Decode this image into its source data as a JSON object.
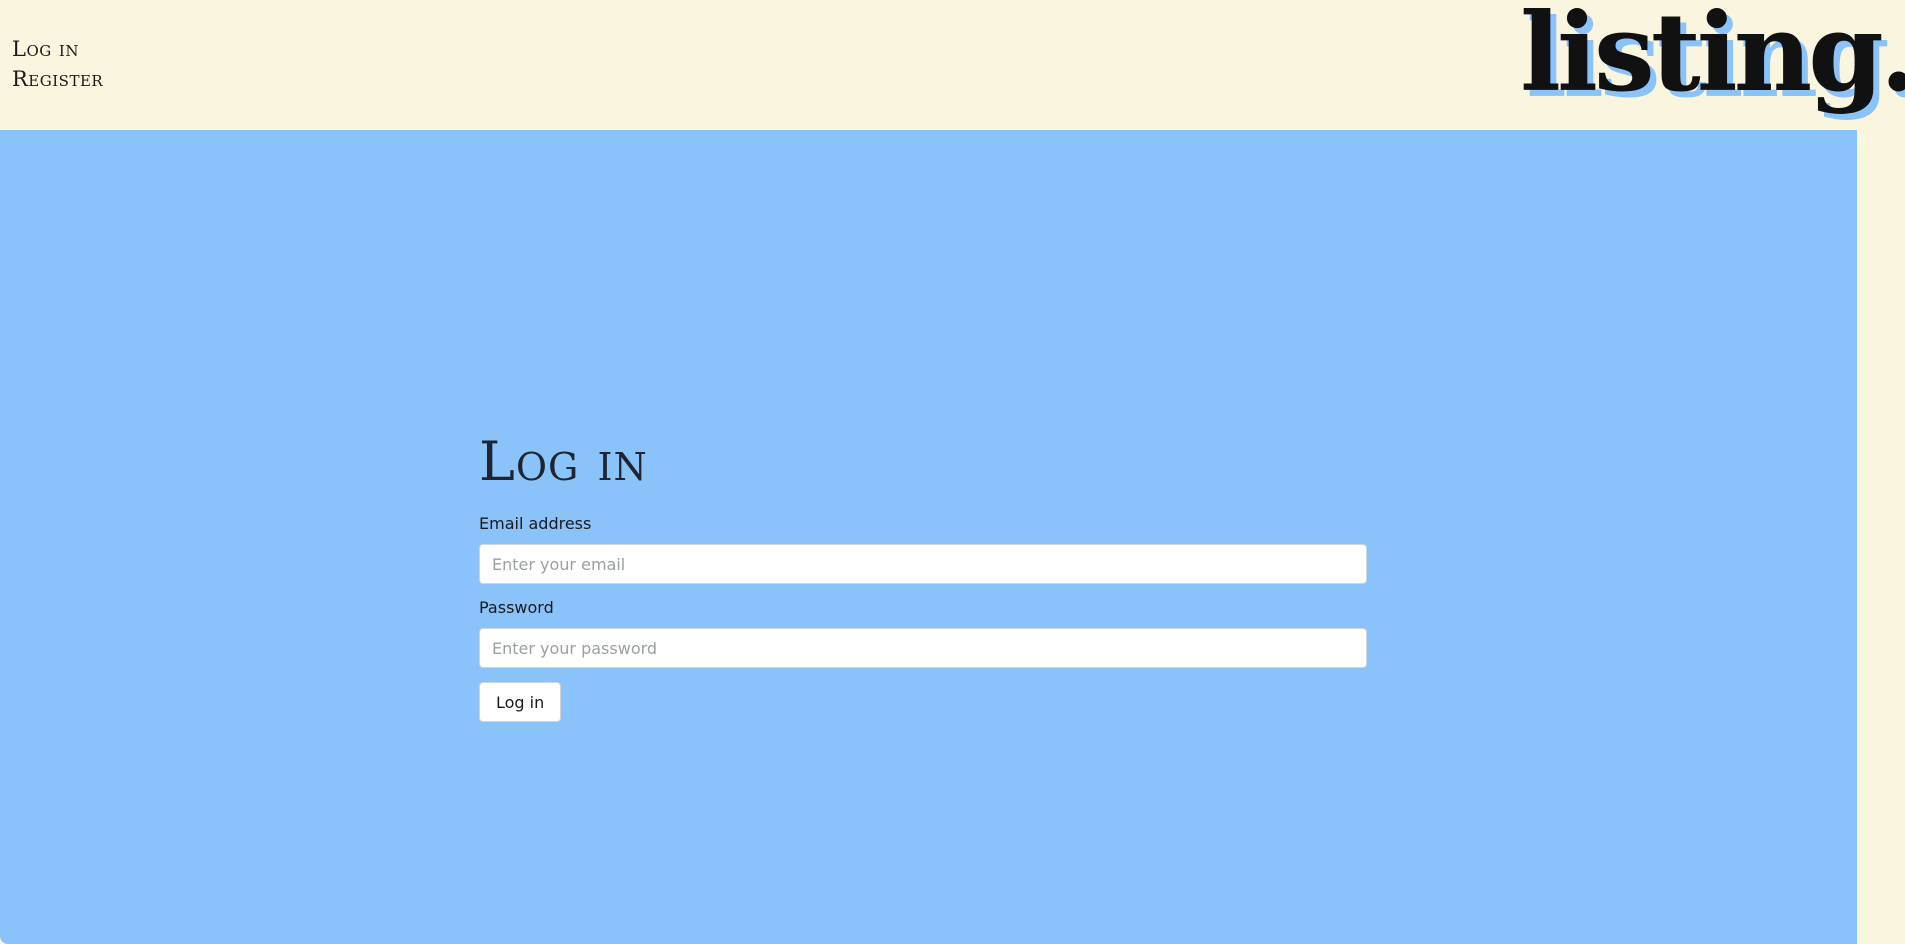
{
  "nav": {
    "login_label": "Log in",
    "register_label": "Register"
  },
  "logo": {
    "text": "listing."
  },
  "login_form": {
    "title": "Log in",
    "email_label": "Email address",
    "email_placeholder": "Enter your email",
    "email_value": "",
    "password_label": "Password",
    "password_placeholder": "Enter your password",
    "password_value": "",
    "submit_label": "Log in"
  },
  "colors": {
    "header_background": "#faf5df",
    "main_background": "#89c3fa",
    "logo_shadow": "#89c3fa"
  }
}
